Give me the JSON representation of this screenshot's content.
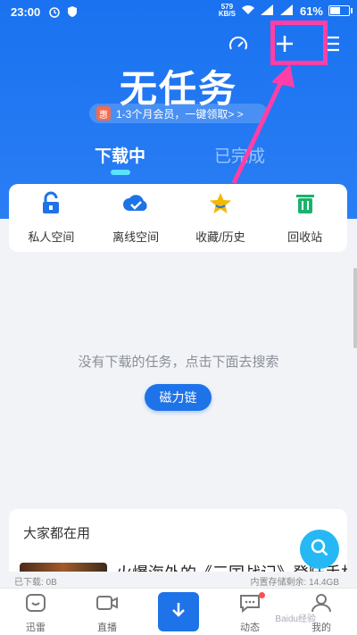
{
  "status": {
    "time": "23:00",
    "net_speed_value": "579",
    "net_speed_unit": "KB/S",
    "network": "4G",
    "network2": "4G",
    "battery": "61%",
    "battery_level": 0.61
  },
  "header": {
    "title": "无任务",
    "promo_badge": "惠",
    "promo_text": "1-3个月会员，一键领取> >"
  },
  "tabs": [
    {
      "label": "下载中",
      "active": true
    },
    {
      "label": "已完成",
      "active": false
    }
  ],
  "shortcuts": [
    {
      "label": "私人空间",
      "icon": "lock-icon"
    },
    {
      "label": "离线空间",
      "icon": "cloud-check-icon"
    },
    {
      "label": "收藏/历史",
      "icon": "star-icon"
    },
    {
      "label": "回收站",
      "icon": "trash-icon"
    }
  ],
  "empty": {
    "message": "没有下载的任务，点击下面去搜索",
    "button": "磁力链"
  },
  "popular": {
    "title": "大家都在用",
    "headline": "火爆海外的《三国战记》登陆手机"
  },
  "storage": {
    "downloaded": "已下载: 0B",
    "remaining": "内置存储剩余: 14.4GB"
  },
  "nav": [
    {
      "label": "迅雷",
      "icon": "xunlei-home-icon"
    },
    {
      "label": "直播",
      "icon": "video-icon"
    },
    {
      "label": "",
      "icon": "download-icon"
    },
    {
      "label": "动态",
      "icon": "chat-icon"
    },
    {
      "label": "我的",
      "icon": "user-icon"
    }
  ],
  "colors": {
    "brand_blue": "#1a72f0",
    "highlight_pink": "#ff3fa7",
    "fab_cyan": "#26b8f5"
  },
  "watermark": "Baidu经验"
}
